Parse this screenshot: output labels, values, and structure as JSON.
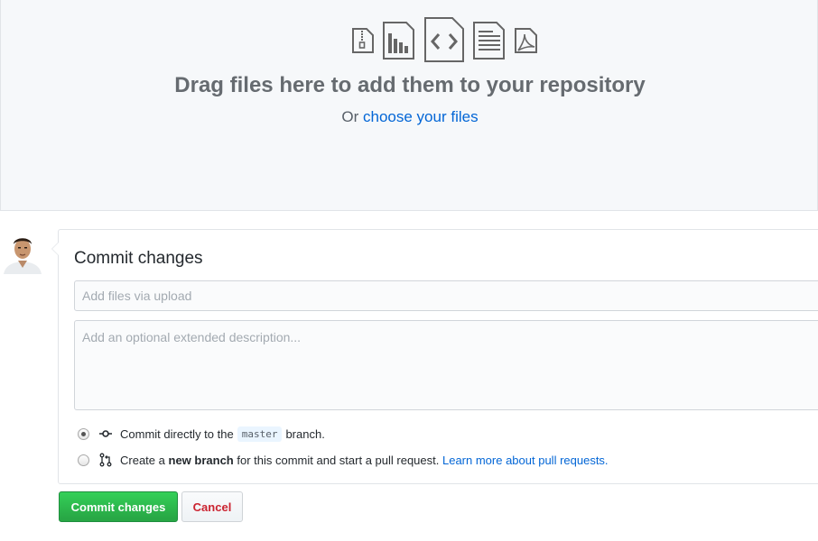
{
  "dropzone": {
    "title": "Drag files here to add them to your repository",
    "sub_prefix": "Or ",
    "sub_link": "choose your files",
    "icons": [
      "file-zip-icon",
      "file-chart-icon",
      "file-code-icon",
      "file-text-icon",
      "file-pdf-icon"
    ]
  },
  "commit": {
    "title": "Commit changes",
    "summary_placeholder": "Add files via upload",
    "description_placeholder": "Add an optional extended description...",
    "option_direct": {
      "prefix": "Commit directly to the",
      "branch": "master",
      "suffix": "branch.",
      "checked": true
    },
    "option_new_branch": {
      "prefix": "Create a",
      "bold": "new branch",
      "middle": "for this commit and start a pull request.",
      "link": "Learn more about pull requests.",
      "checked": false
    },
    "commit_button": "Commit changes",
    "cancel_button": "Cancel"
  },
  "colors": {
    "accent": "#0366d6",
    "commit_green": "#28a745",
    "cancel_red": "#cb2431"
  }
}
